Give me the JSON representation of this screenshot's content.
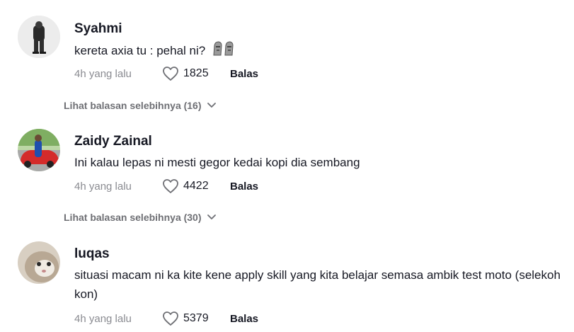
{
  "comments": [
    {
      "username": "Syahmi",
      "text": "kereta axia tu : pehal ni?",
      "emoji_icon": "moai-emoji-pair",
      "time": "4h yang lalu",
      "likes": "1825",
      "reply_label": "Balas",
      "more_replies": "Lihat balasan selebihnya (16)"
    },
    {
      "username": "Zaidy Zainal",
      "text": "Ini kalau lepas ni mesti gegor kedai kopi dia sembang",
      "time": "4h yang lalu",
      "likes": "4422",
      "reply_label": "Balas",
      "more_replies": "Lihat balasan selebihnya (30)"
    },
    {
      "username": "luqas",
      "text": "situasi macam ni ka kite kene apply skill yang kita belajar semasa ambik test moto (selekoh kon)",
      "time": "4h yang lalu",
      "likes": "5379",
      "reply_label": "Balas"
    }
  ],
  "icons": {
    "like": "heart-outline-icon",
    "expand": "chevron-down-icon"
  },
  "colors": {
    "text_primary": "#161823",
    "text_secondary": "#8a8b91",
    "background": "#ffffff"
  }
}
